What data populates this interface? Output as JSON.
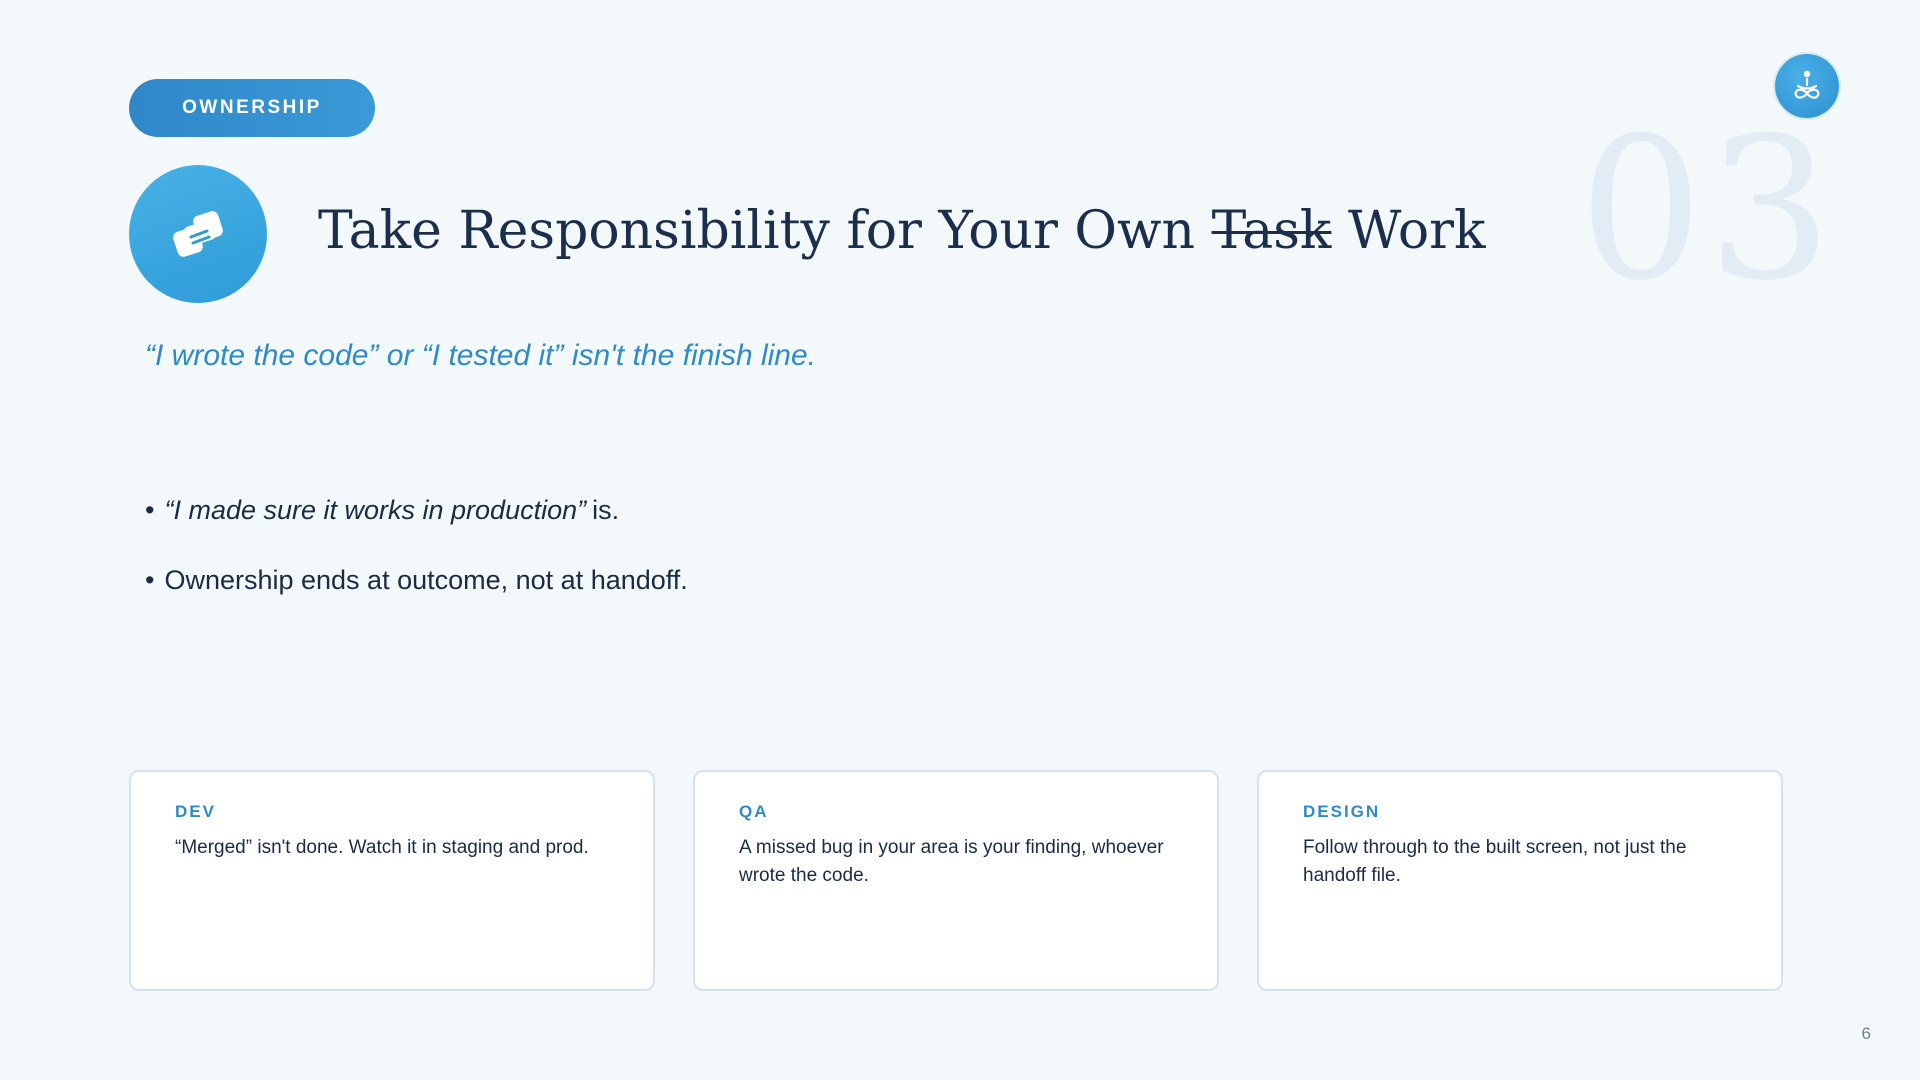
{
  "badge": {
    "label": "OWNERSHIP"
  },
  "logo": {
    "icon": "meditation-figure-icon"
  },
  "section_number": "03",
  "title": {
    "icon": "handshake-icon",
    "prefix": "Take Responsibility for Your Own",
    "struck": "Task",
    "suffix": "Work"
  },
  "subtitle": "“I wrote the code” or “I tested it” isn't the finish line.",
  "bullets": [
    {
      "bullet": "•",
      "emphasis": "“I made sure it works in production”",
      "text": "is."
    },
    {
      "bullet": "•",
      "emphasis": "",
      "text": "Ownership ends at outcome, not at handoff."
    }
  ],
  "cards": [
    {
      "label": "DEV",
      "text": "“Merged” isn't done. Watch it in staging and prod."
    },
    {
      "label": "QA",
      "text": "A missed bug in your area is your finding, whoever wrote the code."
    },
    {
      "label": "DESIGN",
      "text": "Follow through to the built screen, not just the handoff file."
    }
  ],
  "page_number": "6",
  "colors": {
    "accent": "#2f8ac6",
    "title": "#1b2f4d",
    "background": "#f3f8fb",
    "watermark_number": "#e1ecf5"
  }
}
